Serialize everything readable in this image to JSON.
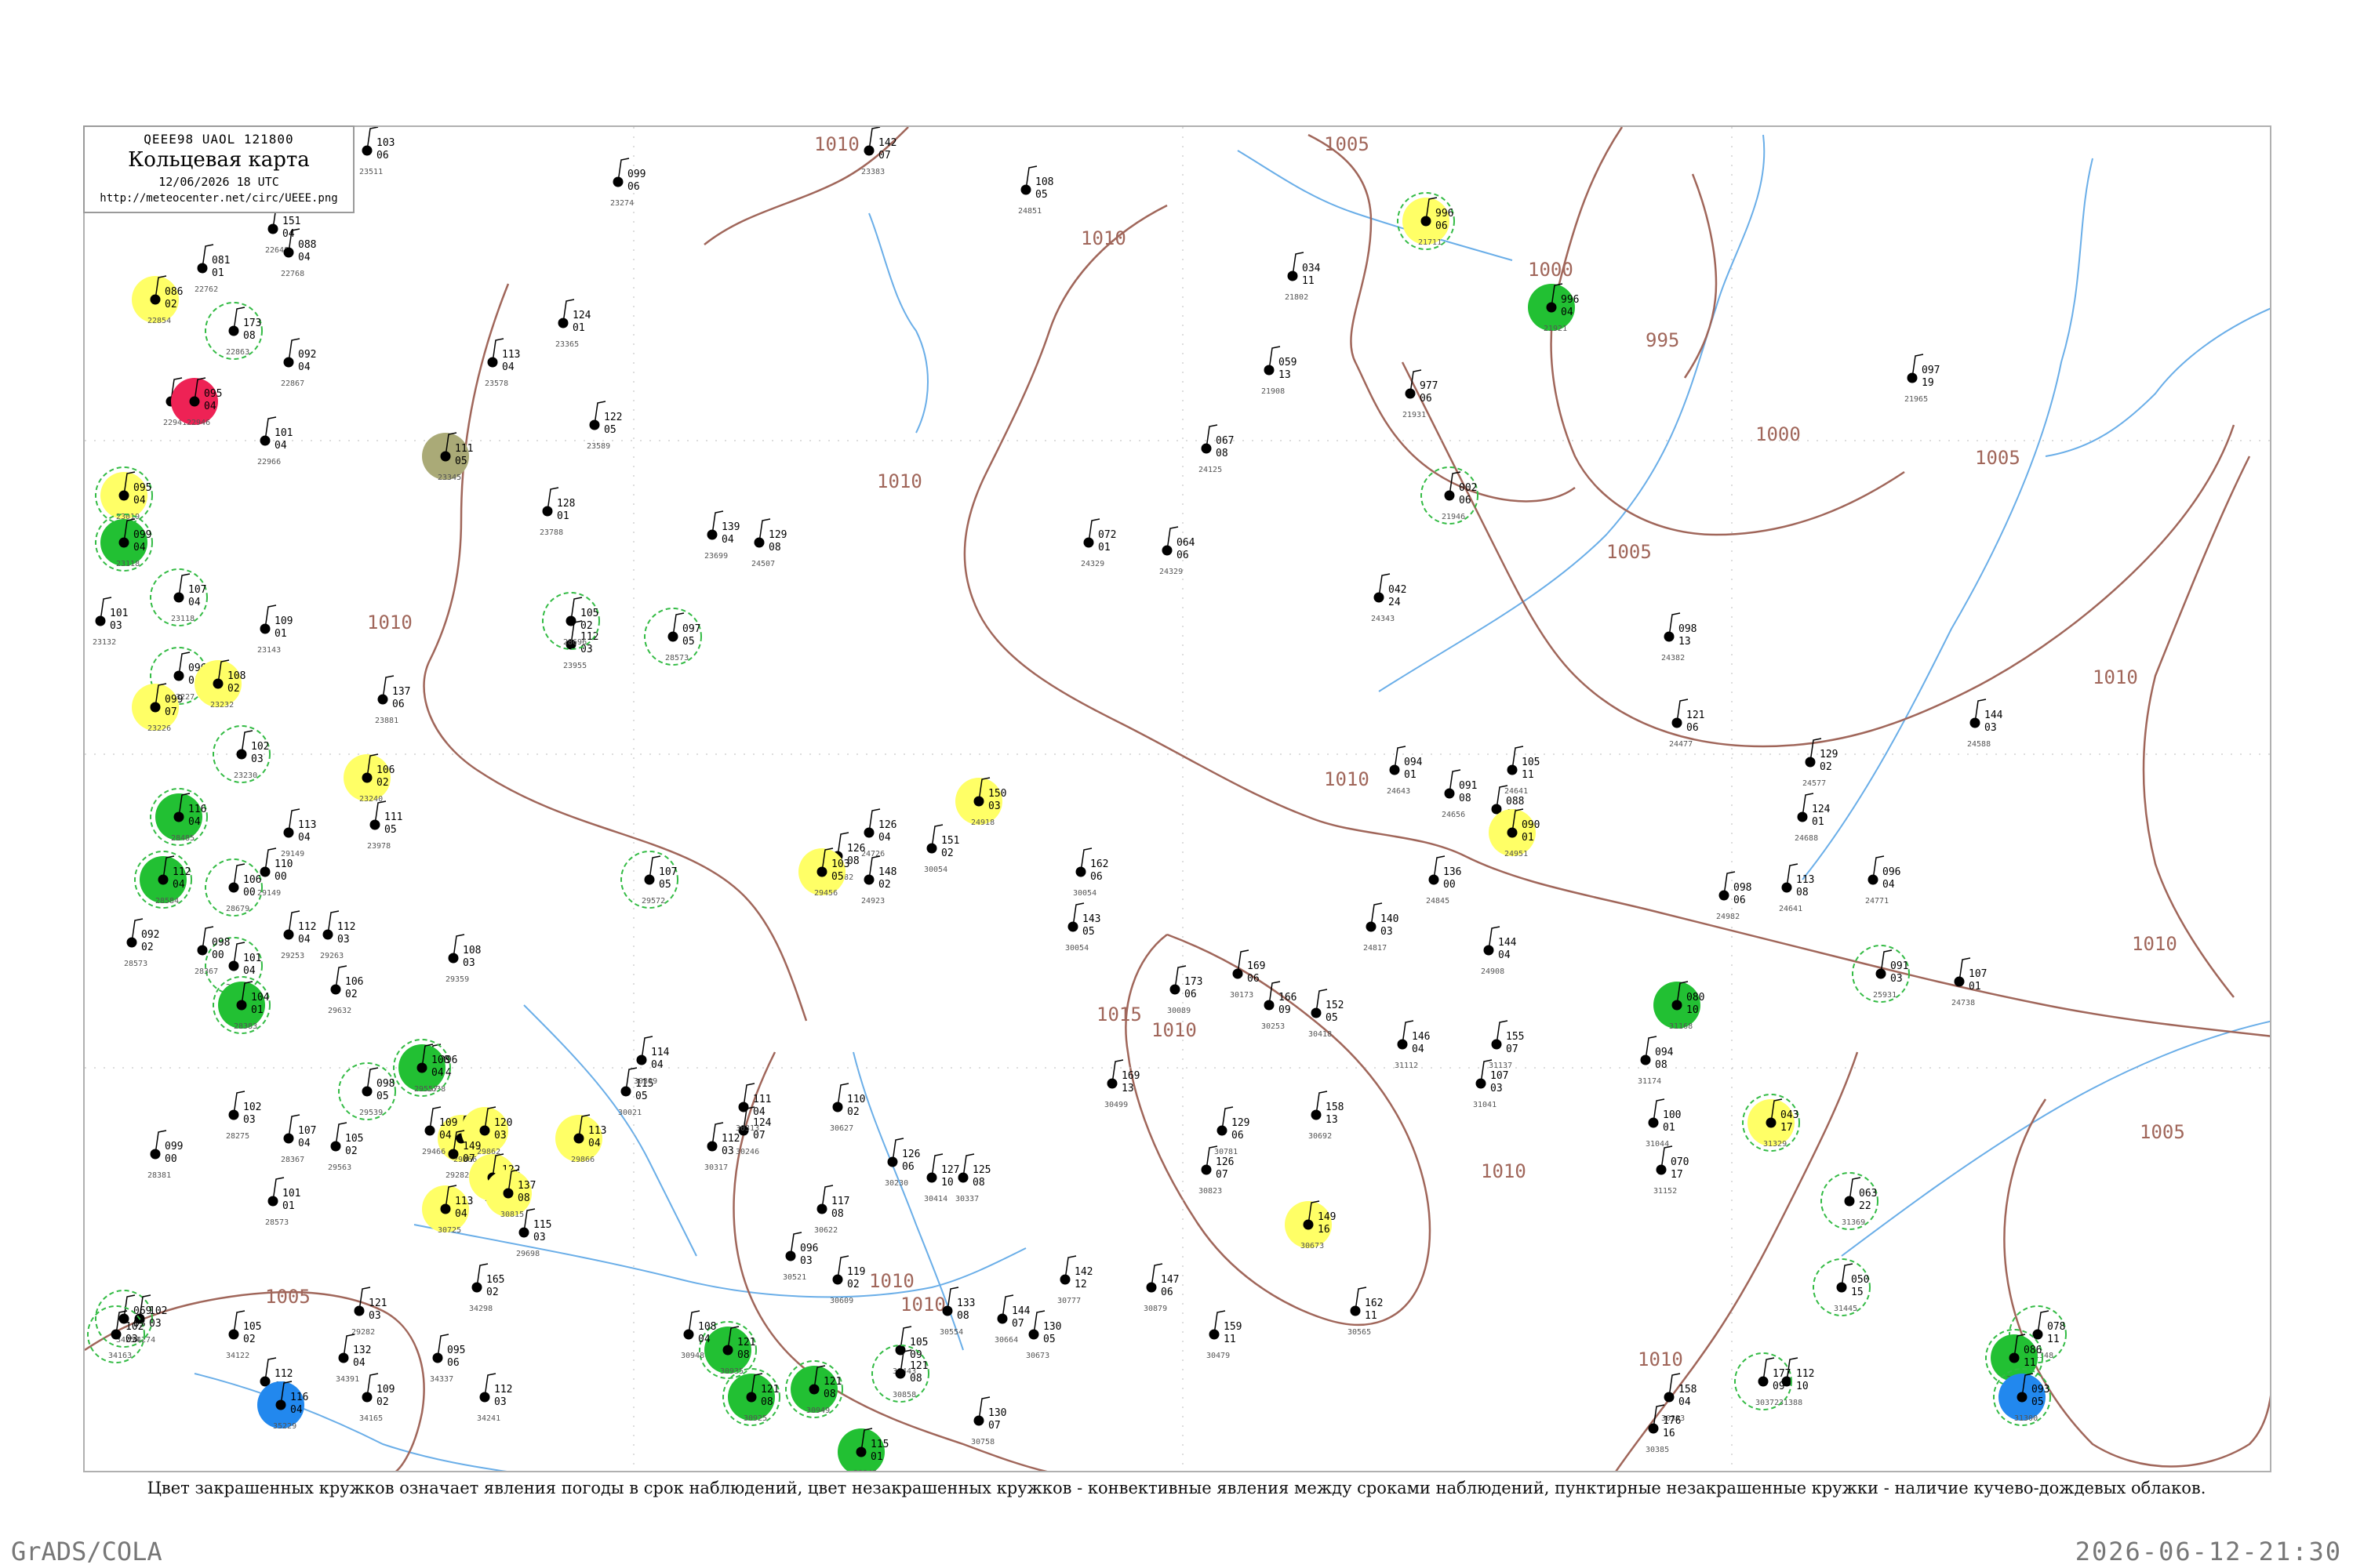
{
  "header": {
    "code": "QEEE98  UAOL  121800",
    "title": "Кольцевая карта",
    "date": "12/06/2026 18 UTC",
    "url": "http://meteocenter.net/circ/UEEE.png"
  },
  "caption": "Цвет закрашенных кружков означает явления погоды в срок наблюдений, цвет незакрашенных кружков - конвективные явления между сроками наблюдений, пунктирные незакрашенные кружки - наличие кучево-дождевых облаков.",
  "footer": {
    "left": "GrADS/COLA",
    "right": "2026-06-12-21:30"
  },
  "colors": {
    "isobar": "#a0665a",
    "river": "#6aaee8",
    "station": "#000000",
    "yellow": "#ffff66",
    "green": "#22c033",
    "red": "#ee2255",
    "blue": "#2288ee",
    "olive": "#aaaa77",
    "dashed_ring": "#33bb44"
  },
  "isobar_labels": [
    {
      "text": "1010",
      "at": "top-center"
    },
    {
      "text": "1005",
      "at": "top"
    },
    {
      "text": "1010",
      "at": "upper-center"
    },
    {
      "text": "1000",
      "at": "north-east"
    },
    {
      "text": "995",
      "at": "north-east"
    },
    {
      "text": "1000",
      "at": "east"
    },
    {
      "text": "1005",
      "at": "east"
    },
    {
      "text": "1005",
      "at": "east"
    },
    {
      "text": "1010",
      "at": "center"
    },
    {
      "text": "1010",
      "at": "east"
    },
    {
      "text": "1010",
      "at": "center-west"
    },
    {
      "text": "1010",
      "at": "west"
    },
    {
      "text": "1010",
      "at": "south-east"
    },
    {
      "text": "1005",
      "at": "south-east"
    },
    {
      "text": "1015",
      "at": "south-center"
    },
    {
      "text": "1010",
      "at": "south"
    },
    {
      "text": "1010",
      "at": "south"
    },
    {
      "text": "1010",
      "at": "south-west"
    },
    {
      "text": "1005",
      "at": "south-west"
    },
    {
      "text": "1010",
      "at": "south-east"
    },
    {
      "text": "1010",
      "at": "south-east"
    }
  ],
  "stations": [
    {
      "t": "103",
      "l": "06",
      "n": "23511",
      "f": null,
      "d": false
    },
    {
      "t": "151",
      "l": "04",
      "n": "22648",
      "f": null,
      "d": false
    },
    {
      "t": "088",
      "l": "04",
      "n": "22768",
      "f": null,
      "d": false
    },
    {
      "t": "081",
      "l": "01",
      "n": "22762",
      "f": null,
      "d": false
    },
    {
      "t": "086",
      "l": "02",
      "n": "22854",
      "f": "yellow",
      "d": false
    },
    {
      "t": "173",
      "l": "08",
      "n": "22863",
      "f": null,
      "d": true
    },
    {
      "t": "092",
      "l": "04",
      "n": "22867",
      "f": null,
      "d": false
    },
    {
      "t": "083",
      "l": "04",
      "n": "22941",
      "f": null,
      "d": false
    },
    {
      "t": "095",
      "l": "04",
      "n": "22946",
      "f": "red",
      "d": false
    },
    {
      "t": "101",
      "l": "04",
      "n": "22966",
      "f": null,
      "d": false
    },
    {
      "t": "095",
      "l": "04",
      "n": "23019",
      "f": "yellow",
      "d": true
    },
    {
      "t": "099",
      "l": "04",
      "n": "23118",
      "f": "green",
      "d": true
    },
    {
      "t": "107",
      "l": "04",
      "n": "23118",
      "f": null,
      "d": true
    },
    {
      "t": "101",
      "l": "03",
      "n": "23132",
      "f": null,
      "d": false
    },
    {
      "t": "109",
      "l": "01",
      "n": "23143",
      "f": null,
      "d": false
    },
    {
      "t": "096",
      "l": "01",
      "n": "23227",
      "f": null,
      "d": true
    },
    {
      "t": "099",
      "l": "07",
      "n": "23226",
      "f": "yellow",
      "d": false
    },
    {
      "t": "108",
      "l": "02",
      "n": "23232",
      "f": "yellow",
      "d": false
    },
    {
      "t": "102",
      "l": "03",
      "n": "23230",
      "f": null,
      "d": true
    },
    {
      "t": "106",
      "l": "02",
      "n": "23240",
      "f": "yellow",
      "d": false
    },
    {
      "t": "111",
      "l": "05",
      "n": "23345",
      "f": "olive",
      "d": false
    },
    {
      "t": "113",
      "l": "04",
      "n": "23578",
      "f": null,
      "d": false
    },
    {
      "t": "122",
      "l": "05",
      "n": "23589",
      "f": null,
      "d": false
    },
    {
      "t": "124",
      "l": "01",
      "n": "23365",
      "f": null,
      "d": false
    },
    {
      "t": "128",
      "l": "01",
      "n": "23788",
      "f": null,
      "d": false
    },
    {
      "t": "112",
      "l": "03",
      "n": "23955",
      "f": null,
      "d": false
    },
    {
      "t": "129",
      "l": "08",
      "n": "24507",
      "f": null,
      "d": false
    },
    {
      "t": "139",
      "l": "04",
      "n": "23699",
      "f": null,
      "d": false
    },
    {
      "t": "099",
      "l": "06",
      "n": "23274",
      "f": null,
      "d": false
    },
    {
      "t": "142",
      "l": "07",
      "n": "23383",
      "f": null,
      "d": false
    },
    {
      "t": "108",
      "l": "05",
      "n": "24851",
      "f": null,
      "d": false
    },
    {
      "t": "034",
      "l": "11",
      "n": "21802",
      "f": null,
      "d": false
    },
    {
      "t": "996",
      "l": "06",
      "n": "21711",
      "f": "yellow",
      "d": true
    },
    {
      "t": "996",
      "l": "04",
      "n": "21921",
      "f": "green",
      "d": false
    },
    {
      "t": "977",
      "l": "06",
      "n": "21931",
      "f": null,
      "d": false
    },
    {
      "t": "002",
      "l": "06",
      "n": "21946",
      "f": null,
      "d": true
    },
    {
      "t": "097",
      "l": "19",
      "n": "21965",
      "f": null,
      "d": false
    },
    {
      "t": "067",
      "l": "08",
      "n": "24125",
      "f": null,
      "d": false
    },
    {
      "t": "059",
      "l": "13",
      "n": "21908",
      "f": null,
      "d": false
    },
    {
      "t": "072",
      "l": "01",
      "n": "24329",
      "f": null,
      "d": false
    },
    {
      "t": "064",
      "l": "06",
      "n": "24329",
      "f": null,
      "d": false
    },
    {
      "t": "042",
      "l": "24",
      "n": "24343",
      "f": null,
      "d": false
    },
    {
      "t": "098",
      "l": "13",
      "n": "24382",
      "f": null,
      "d": false
    },
    {
      "t": "144",
      "l": "03",
      "n": "24588",
      "f": null,
      "d": false
    },
    {
      "t": "121",
      "l": "06",
      "n": "24477",
      "f": null,
      "d": false
    },
    {
      "t": "129",
      "l": "02",
      "n": "24577",
      "f": null,
      "d": false
    },
    {
      "t": "124",
      "l": "01",
      "n": "24688",
      "f": null,
      "d": false
    },
    {
      "t": "096",
      "l": "04",
      "n": "24771",
      "f": null,
      "d": false
    },
    {
      "t": "098",
      "l": "06",
      "n": "24982",
      "f": null,
      "d": false
    },
    {
      "t": "091",
      "l": "03",
      "n": "25931",
      "f": null,
      "d": true
    },
    {
      "t": "107",
      "l": "01",
      "n": "24738",
      "f": null,
      "d": false
    },
    {
      "t": "113",
      "l": "08",
      "n": "24641",
      "f": null,
      "d": false
    },
    {
      "t": "105",
      "l": "11",
      "n": "24641",
      "f": null,
      "d": false
    },
    {
      "t": "094",
      "l": "01",
      "n": "24643",
      "f": null,
      "d": false
    },
    {
      "t": "091",
      "l": "08",
      "n": "24656",
      "f": null,
      "d": false
    },
    {
      "t": "088",
      "l": "03",
      "n": "24839",
      "f": null,
      "d": false
    },
    {
      "t": "090",
      "l": "01",
      "n": "24951",
      "f": "yellow",
      "d": false
    },
    {
      "t": "136",
      "l": "00",
      "n": "24845",
      "f": null,
      "d": false
    },
    {
      "t": "144",
      "l": "04",
      "n": "24908",
      "f": null,
      "d": false
    },
    {
      "t": "140",
      "l": "03",
      "n": "24817",
      "f": null,
      "d": false
    },
    {
      "t": "150",
      "l": "03",
      "n": "24918",
      "f": "yellow",
      "d": false
    },
    {
      "t": "126",
      "l": "04",
      "n": "24726",
      "f": null,
      "d": false
    },
    {
      "t": "148",
      "l": "02",
      "n": "24923",
      "f": null,
      "d": false
    },
    {
      "t": "151",
      "l": "02",
      "n": "30054",
      "f": null,
      "d": false
    },
    {
      "t": "162",
      "l": "06",
      "n": "30054",
      "f": null,
      "d": false
    },
    {
      "t": "143",
      "l": "05",
      "n": "30054",
      "f": null,
      "d": false
    },
    {
      "t": "169",
      "l": "06",
      "n": "30173",
      "f": null,
      "d": false
    },
    {
      "t": "173",
      "l": "06",
      "n": "30089",
      "f": null,
      "d": false
    },
    {
      "t": "166",
      "l": "09",
      "n": "30253",
      "f": null,
      "d": false
    },
    {
      "t": "152",
      "l": "05",
      "n": "30418",
      "f": null,
      "d": false
    },
    {
      "t": "146",
      "l": "04",
      "n": "31112",
      "f": null,
      "d": false
    },
    {
      "t": "155",
      "l": "07",
      "n": "31137",
      "f": null,
      "d": false
    },
    {
      "t": "107",
      "l": "03",
      "n": "31041",
      "f": null,
      "d": false
    },
    {
      "t": "100",
      "l": "01",
      "n": "31044",
      "f": null,
      "d": false
    },
    {
      "t": "070",
      "l": "17",
      "n": "31152",
      "f": null,
      "d": false
    },
    {
      "t": "080",
      "l": "10",
      "n": "31168",
      "f": "green",
      "d": false
    },
    {
      "t": "094",
      "l": "08",
      "n": "31174",
      "f": null,
      "d": false
    },
    {
      "t": "043",
      "l": "17",
      "n": "31329",
      "f": "yellow",
      "d": true
    },
    {
      "t": "063",
      "l": "22",
      "n": "31369",
      "f": null,
      "d": true
    },
    {
      "t": "050",
      "l": "15",
      "n": "31445",
      "f": null,
      "d": true
    },
    {
      "t": "078",
      "l": "11",
      "n": "31348",
      "f": null,
      "d": true
    },
    {
      "t": "086",
      "l": "11",
      "n": "31304",
      "f": "green",
      "d": true
    },
    {
      "t": "093",
      "l": "05",
      "n": "31300",
      "f": "blue",
      "d": true
    },
    {
      "t": "112",
      "l": "10",
      "n": "31388",
      "f": null,
      "d": false
    },
    {
      "t": "177",
      "l": "09",
      "n": "30372",
      "f": null,
      "d": true
    },
    {
      "t": "158",
      "l": "04",
      "n": "30393",
      "f": null,
      "d": false
    },
    {
      "t": "176",
      "l": "16",
      "n": "30385",
      "f": null,
      "d": false
    },
    {
      "t": "169",
      "l": "13",
      "n": "30499",
      "f": null,
      "d": false
    },
    {
      "t": "158",
      "l": "13",
      "n": "30692",
      "f": null,
      "d": false
    },
    {
      "t": "129",
      "l": "06",
      "n": "30781",
      "f": null,
      "d": false
    },
    {
      "t": "126",
      "l": "07",
      "n": "30823",
      "f": null,
      "d": false
    },
    {
      "t": "149",
      "l": "16",
      "n": "30673",
      "f": "yellow",
      "d": false
    },
    {
      "t": "162",
      "l": "11",
      "n": "30565",
      "f": null,
      "d": false
    },
    {
      "t": "159",
      "l": "11",
      "n": "30479",
      "f": null,
      "d": false
    },
    {
      "t": "147",
      "l": "06",
      "n": "30879",
      "f": null,
      "d": false
    },
    {
      "t": "142",
      "l": "12",
      "n": "30777",
      "f": null,
      "d": false
    },
    {
      "t": "144",
      "l": "07",
      "n": "30664",
      "f": null,
      "d": false
    },
    {
      "t": "130",
      "l": "05",
      "n": "30673",
      "f": null,
      "d": false
    },
    {
      "t": "133",
      "l": "08",
      "n": "30554",
      "f": null,
      "d": false
    },
    {
      "t": "105",
      "l": "09",
      "n": "30443",
      "f": null,
      "d": false
    },
    {
      "t": "119",
      "l": "02",
      "n": "30609",
      "f": null,
      "d": false
    },
    {
      "t": "130",
      "l": "07",
      "n": "30758",
      "f": null,
      "d": false
    },
    {
      "t": "121",
      "l": "08",
      "n": "30858",
      "f": null,
      "d": true
    },
    {
      "t": "121",
      "l": "08",
      "n": "30935",
      "f": "green",
      "d": true
    },
    {
      "t": "121",
      "l": "08",
      "n": "30949",
      "f": "green",
      "d": true
    },
    {
      "t": "121",
      "l": "08",
      "n": "30925",
      "f": "green",
      "d": true
    },
    {
      "t": "115",
      "l": "01",
      "n": "30843",
      "f": "green",
      "d": false
    },
    {
      "t": "108",
      "l": "04",
      "n": "30948",
      "f": null,
      "d": false
    },
    {
      "t": "096",
      "l": "03",
      "n": "30521",
      "f": null,
      "d": false
    },
    {
      "t": "117",
      "l": "08",
      "n": "30622",
      "f": null,
      "d": false
    },
    {
      "t": "110",
      "l": "02",
      "n": "30627",
      "f": null,
      "d": false
    },
    {
      "t": "127",
      "l": "10",
      "n": "30414",
      "f": null,
      "d": false
    },
    {
      "t": "125",
      "l": "08",
      "n": "30337",
      "f": null,
      "d": false
    },
    {
      "t": "126",
      "l": "06",
      "n": "30230",
      "f": null,
      "d": false
    },
    {
      "t": "124",
      "l": "07",
      "n": "30246",
      "f": null,
      "d": false
    },
    {
      "t": "112",
      "l": "03",
      "n": "30317",
      "f": null,
      "d": false
    },
    {
      "t": "111",
      "l": "04",
      "n": "30313",
      "f": null,
      "d": false
    },
    {
      "t": "115",
      "l": "05",
      "n": "30021",
      "f": null,
      "d": false
    },
    {
      "t": "114",
      "l": "04",
      "n": "30309",
      "f": null,
      "d": false
    },
    {
      "t": "113",
      "l": "04",
      "n": "29866",
      "f": "yellow",
      "d": false
    },
    {
      "t": "112",
      "l": "03",
      "n": "29866",
      "f": "yellow",
      "d": false
    },
    {
      "t": "120",
      "l": "03",
      "n": "29862",
      "f": "yellow",
      "d": false
    },
    {
      "t": "122",
      "l": "02",
      "n": "29863",
      "f": "yellow",
      "d": false
    },
    {
      "t": "137",
      "l": "08",
      "n": "30815",
      "f": "yellow",
      "d": false
    },
    {
      "t": "113",
      "l": "04",
      "n": "30725",
      "f": "yellow",
      "d": false
    },
    {
      "t": "115",
      "l": "03",
      "n": "29698",
      "f": null,
      "d": false
    },
    {
      "t": "121",
      "l": "03",
      "n": "29282",
      "f": null,
      "d": false
    },
    {
      "t": "149",
      "l": "07",
      "n": "29282",
      "f": null,
      "d": false
    },
    {
      "t": "126",
      "l": "08",
      "n": "29282",
      "f": null,
      "d": false
    },
    {
      "t": "103",
      "l": "05",
      "n": "29456",
      "f": "yellow",
      "d": false
    },
    {
      "t": "107",
      "l": "05",
      "n": "29572",
      "f": null,
      "d": true
    },
    {
      "t": "106",
      "l": "02",
      "n": "29632",
      "f": null,
      "d": false
    },
    {
      "t": "096",
      "l": "04",
      "n": "29638",
      "f": null,
      "d": false
    },
    {
      "t": "108",
      "l": "04",
      "n": "29557",
      "f": "green",
      "d": true
    },
    {
      "t": "098",
      "l": "05",
      "n": "29539",
      "f": null,
      "d": true
    },
    {
      "t": "105",
      "l": "02",
      "n": "29563",
      "f": null,
      "d": false
    },
    {
      "t": "109",
      "l": "04",
      "n": "29466",
      "f": null,
      "d": false
    },
    {
      "t": "108",
      "l": "03",
      "n": "29359",
      "f": null,
      "d": false
    },
    {
      "t": "112",
      "l": "03",
      "n": "29263",
      "f": null,
      "d": false
    },
    {
      "t": "112",
      "l": "04",
      "n": "29253",
      "f": null,
      "d": false
    },
    {
      "t": "110",
      "l": "00",
      "n": "29149",
      "f": null,
      "d": false
    },
    {
      "t": "113",
      "l": "04",
      "n": "29149",
      "f": null,
      "d": false
    },
    {
      "t": "111",
      "l": "05",
      "n": "23978",
      "f": null,
      "d": false
    },
    {
      "t": "137",
      "l": "06",
      "n": "23881",
      "f": null,
      "d": false
    },
    {
      "t": "105",
      "l": "02",
      "n": "28696",
      "f": null,
      "d": true
    },
    {
      "t": "097",
      "l": "05",
      "n": "28573",
      "f": null,
      "d": true
    },
    {
      "t": "116",
      "l": "04",
      "n": "28485",
      "f": "green",
      "d": true
    },
    {
      "t": "112",
      "l": "04",
      "n": "28584",
      "f": "green",
      "d": true
    },
    {
      "t": "106",
      "l": "00",
      "n": "28679",
      "f": null,
      "d": true
    },
    {
      "t": "101",
      "l": "04",
      "n": "28688",
      "f": null,
      "d": true
    },
    {
      "t": "104",
      "l": "01",
      "n": "28383",
      "f": "green",
      "d": true
    },
    {
      "t": "102",
      "l": "03",
      "n": "28275",
      "f": null,
      "d": false
    },
    {
      "t": "098",
      "l": "00",
      "n": "28367",
      "f": null,
      "d": false
    },
    {
      "t": "092",
      "l": "02",
      "n": "28573",
      "f": null,
      "d": false
    },
    {
      "t": "099",
      "l": "00",
      "n": "28381",
      "f": null,
      "d": false
    },
    {
      "t": "107",
      "l": "04",
      "n": "28367",
      "f": null,
      "d": false
    },
    {
      "t": "101",
      "l": "01",
      "n": "28573",
      "f": null,
      "d": false
    },
    {
      "t": "069",
      "l": "03",
      "n": "34254",
      "f": null,
      "d": true
    },
    {
      "t": "105",
      "l": "02",
      "n": "34122",
      "f": null,
      "d": false
    },
    {
      "t": "112",
      "l": "08",
      "n": "34122",
      "f": null,
      "d": false
    },
    {
      "t": "109",
      "l": "02",
      "n": "34165",
      "f": null,
      "d": false
    },
    {
      "t": "116",
      "l": "04",
      "n": "35229",
      "f": "blue",
      "d": false
    },
    {
      "t": "132",
      "l": "04",
      "n": "34391",
      "f": null,
      "d": false
    },
    {
      "t": "095",
      "l": "06",
      "n": "34337",
      "f": null,
      "d": false
    },
    {
      "t": "112",
      "l": "03",
      "n": "34241",
      "f": null,
      "d": false
    },
    {
      "t": "165",
      "l": "02",
      "n": "34298",
      "f": null,
      "d": false
    },
    {
      "t": "102",
      "l": "03",
      "n": "34274",
      "f": null,
      "d": false
    },
    {
      "t": "102",
      "l": "03",
      "n": "34163",
      "f": null,
      "d": true
    }
  ]
}
